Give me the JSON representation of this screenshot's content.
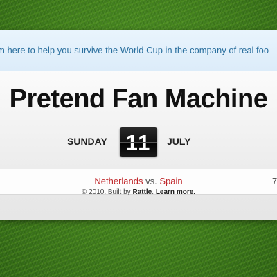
{
  "ticker": {
    "text": "m here to help you survive the World Cup in the company of real foo"
  },
  "header": {
    "title": "Pretend Fan Machine",
    "day": "SUNDAY",
    "date_number": "11",
    "month": "JULY"
  },
  "match": {
    "home_team": "Netherlands",
    "vs": "vs.",
    "away_team": "Spain",
    "score_peek": "7"
  },
  "footer": {
    "copyright": "© 2010. Built by ",
    "brand": "Rattle",
    "separator": ". ",
    "learn_more": "Learn more."
  },
  "colors": {
    "team_red": "#c0282b",
    "ticker_blue": "#2a6f9e",
    "grass_green": "#3f7c1c"
  }
}
